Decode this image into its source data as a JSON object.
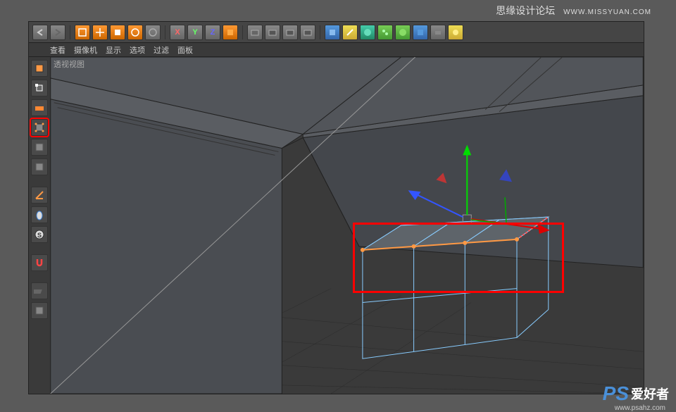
{
  "watermark": {
    "top": "思缘设计论坛",
    "top_url": "WWW.MISSYUAN.COM",
    "bottom_ps": "PS",
    "bottom_txt": "爱好者",
    "bottom_url": "www.psahz.com"
  },
  "menu": {
    "view": "查看",
    "camera": "摄像机",
    "display": "显示",
    "options": "选项",
    "filter": "过滤",
    "panel": "面板"
  },
  "viewport": {
    "label": "透视视图"
  },
  "toolbar": {
    "undo": "撤销",
    "redo": "重做",
    "select": "选择",
    "move": "移动",
    "scale": "缩放",
    "rotate": "旋转",
    "axis_x": "X",
    "axis_y": "Y",
    "axis_z": "Z"
  },
  "left_tools": {
    "make_editable": "可编辑",
    "model": "模型",
    "texture": "纹理",
    "workplane": "工作平面",
    "points": "点",
    "edges": "边",
    "polygons": "多边形",
    "axis": "轴心",
    "enable_snap": "捕捉",
    "locked": "S",
    "magnet": "吸附",
    "tweak": "调整"
  }
}
